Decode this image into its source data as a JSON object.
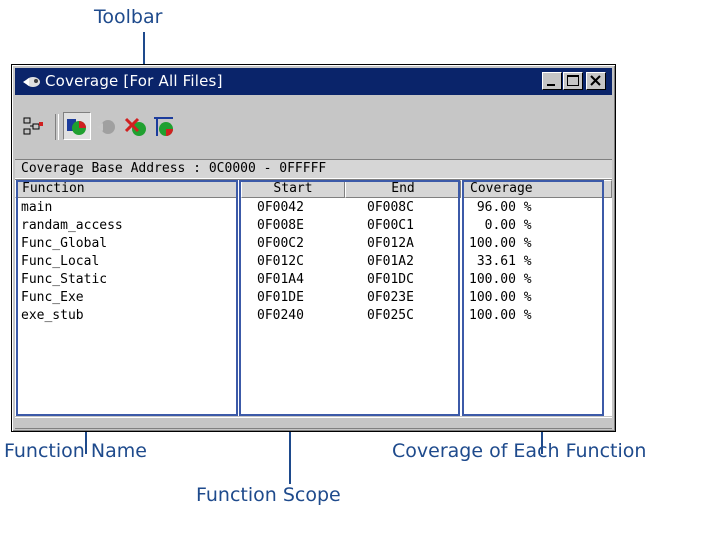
{
  "annotations": {
    "toolbar": "Toolbar",
    "function_name": "Function Name",
    "function_scope": "Function Scope",
    "coverage_each": "Coverage of Each Function"
  },
  "window": {
    "title": "Coverage [For All Files]",
    "buttons": [
      "minimize",
      "maximize",
      "close"
    ]
  },
  "toolbar": {
    "icons": [
      "tree-view-icon",
      "coverage-view-icon",
      "gray-coverage-icon",
      "clear-coverage-icon",
      "coverage-range-icon"
    ]
  },
  "base_address": "Coverage Base Address : 0C0000 - 0FFFFF",
  "table": {
    "headers": {
      "function": "Function",
      "start": "Start",
      "end": "End",
      "coverage": "Coverage"
    },
    "rows": [
      {
        "function": "main",
        "start": "0F0042",
        "end": "0F008C",
        "coverage": " 96.00 %"
      },
      {
        "function": "randam_access",
        "start": "0F008E",
        "end": "0F00C1",
        "coverage": "  0.00 %"
      },
      {
        "function": "Func_Global",
        "start": "0F00C2",
        "end": "0F012A",
        "coverage": "100.00 %"
      },
      {
        "function": "Func_Local",
        "start": "0F012C",
        "end": "0F01A2",
        "coverage": " 33.61 %"
      },
      {
        "function": "Func_Static",
        "start": "0F01A4",
        "end": "0F01DC",
        "coverage": "100.00 %"
      },
      {
        "function": "Func_Exe",
        "start": "0F01DE",
        "end": "0F023E",
        "coverage": "100.00 %"
      },
      {
        "function": "exe_stub",
        "start": "0F0240",
        "end": "0F025C",
        "coverage": "100.00 %"
      }
    ]
  },
  "colors": {
    "titlebar": "#0a246a",
    "pane_border": "#3c5aa8",
    "annotation": "#1e4a8c"
  }
}
